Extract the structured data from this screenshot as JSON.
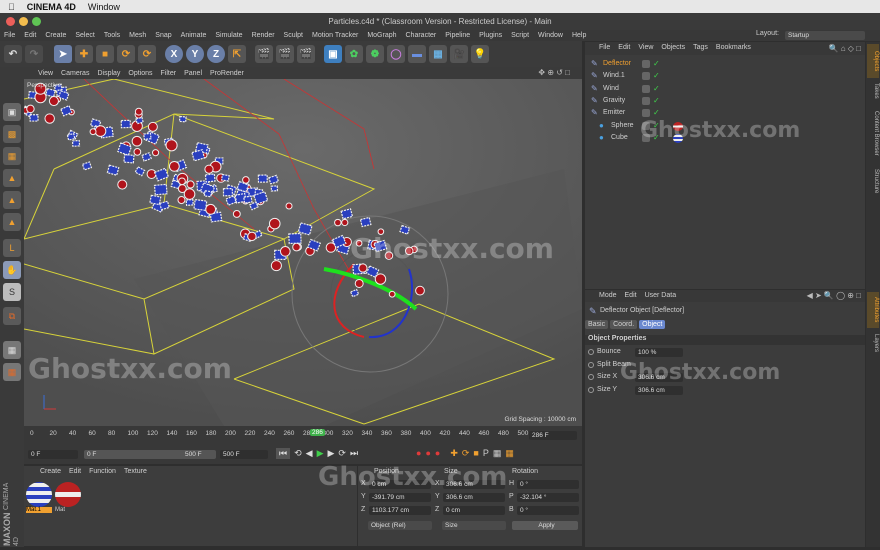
{
  "mac": {
    "apple": "",
    "app": "CINEMA 4D",
    "menu": "Window"
  },
  "title": "Particles.c4d * (Classroom Version - Restricted License) - Main",
  "layout": {
    "label": "Layout:",
    "value": "Startup"
  },
  "menu": [
    "File",
    "Edit",
    "Create",
    "Select",
    "Tools",
    "Mesh",
    "Snap",
    "Animate",
    "Simulate",
    "Render",
    "Sculpt",
    "Motion Tracker",
    "MoGraph",
    "Character",
    "Pipeline",
    "Plugins",
    "Script",
    "Window",
    "Help"
  ],
  "toolbar": {
    "x": "X",
    "y": "Y",
    "z": "Z"
  },
  "viewport_menu": [
    "View",
    "Cameras",
    "Display",
    "Options",
    "Filter",
    "Panel",
    "ProRender"
  ],
  "viewport": {
    "label": "Perspective",
    "grid": "Grid Spacing : 10000 cm"
  },
  "timeline": {
    "ticks": [
      "0",
      "20",
      "40",
      "60",
      "80",
      "100",
      "120",
      "140",
      "160",
      "180",
      "200",
      "220",
      "240",
      "260",
      "28",
      "300",
      "320",
      "340",
      "360",
      "380",
      "400",
      "420",
      "440",
      "460",
      "480",
      "500"
    ],
    "current": "286",
    "frame_field": "286 F"
  },
  "playbar": {
    "start": "0 F",
    "pos": "0 F",
    "end": "500 F",
    "end2": "500 F"
  },
  "materials": {
    "menu": [
      "Create",
      "Edit",
      "Function",
      "Texture"
    ],
    "items": [
      "Mat.1",
      "Mat"
    ]
  },
  "brand": {
    "maxon": "MAXON",
    "c4d": "CINEMA 4D"
  },
  "coords": {
    "headers": [
      "Position",
      "Size",
      "Rotation"
    ],
    "rows": [
      {
        "axis": "X",
        "pos": "0 cm",
        "saxis": "X",
        "size": "306.6 cm",
        "raxis": "H",
        "rot": "0 °"
      },
      {
        "axis": "Y",
        "pos": "-391.79 cm",
        "saxis": "Y",
        "size": "306.6 cm",
        "raxis": "P",
        "rot": "-32.104 °"
      },
      {
        "axis": "Z",
        "pos": "1103.177 cm",
        "saxis": "Z",
        "size": "0 cm",
        "raxis": "B",
        "rot": "0 °"
      }
    ],
    "mode": "Object (Rel)",
    "sizemode": "Size",
    "apply": "Apply"
  },
  "objects": {
    "menu": [
      "File",
      "Edit",
      "View",
      "Objects",
      "Tags",
      "Bookmarks"
    ],
    "items": [
      {
        "name": "Deflector",
        "active": true
      },
      {
        "name": "Wind.1",
        "active": false
      },
      {
        "name": "Wind",
        "active": false
      },
      {
        "name": "Gravity",
        "active": false
      },
      {
        "name": "Emitter",
        "active": false
      },
      {
        "name": "Sphere",
        "active": false
      },
      {
        "name": "Cube",
        "active": false
      }
    ]
  },
  "attributes": {
    "menu": [
      "Mode",
      "Edit",
      "User Data"
    ],
    "header": "Deflector Object [Deflector]",
    "tabs": [
      "Basic",
      "Coord.",
      "Object"
    ],
    "section": "Object Properties",
    "props": [
      {
        "label": "Bounce",
        "value": "100 %"
      },
      {
        "label": "Split Beam",
        "value": ""
      },
      {
        "label": "Size X",
        "value": "306.6 cm"
      },
      {
        "label": "Size Y",
        "value": "306.6 cm"
      }
    ]
  },
  "right_tabs": [
    "Objects",
    "Takes",
    "Content Browser",
    "Structure",
    "Attributes",
    "Layers"
  ],
  "watermark": "Ghostxx.com",
  "watermark2": "Ghostxx.com"
}
